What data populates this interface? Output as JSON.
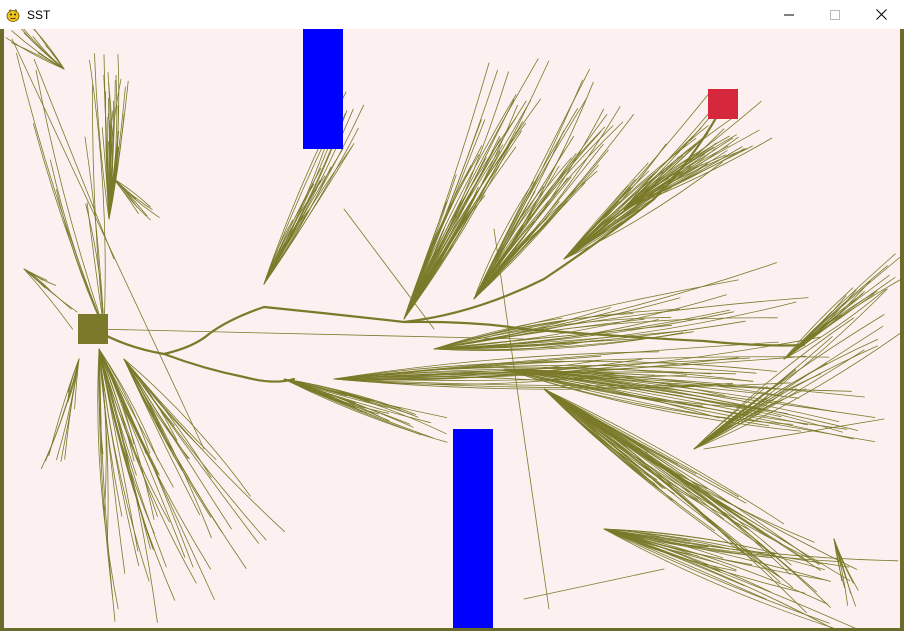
{
  "window": {
    "title": "SST",
    "app_icon": "pygame-snake-icon",
    "controls": {
      "minimize": "minimize-icon",
      "maximize": "maximize-icon",
      "close": "close-icon"
    }
  },
  "canvas": {
    "background_color": "#fdf0f0",
    "tree_color": "#7a7a2a",
    "start_color": "#7a7a2a",
    "goal_color": "#d6283c",
    "obstacle_color": "#0000ff"
  }
}
